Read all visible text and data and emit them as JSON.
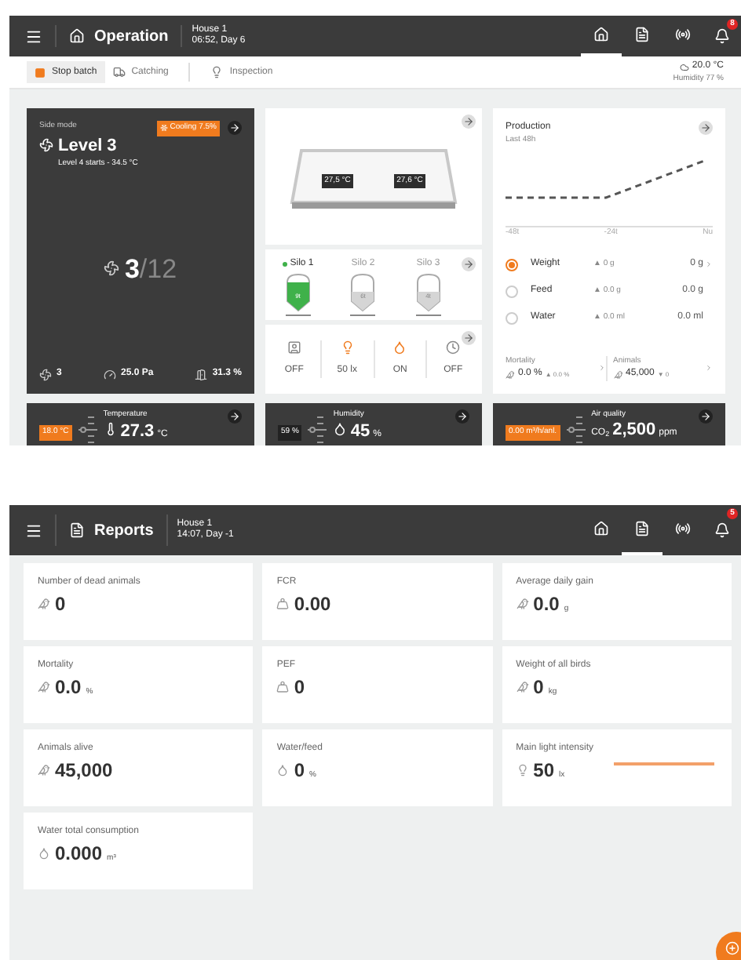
{
  "operation": {
    "header": {
      "title": "Operation",
      "house": "House 1",
      "time": "06:52, Day 6",
      "nav": [
        {
          "selected": true
        },
        {
          "selected": false
        },
        {
          "selected": false
        }
      ],
      "alert_badge": "8"
    },
    "toolbar": {
      "buttons": [
        {
          "label": "Stop batch"
        },
        {
          "label": "Catching"
        },
        {
          "label": "Inspection"
        }
      ],
      "outside_temperature": "20.0 °C",
      "outside_humidity": "Humidity 77 %"
    },
    "ventilation": {
      "mode": "Side mode",
      "badge": "Cooling 7.5%",
      "title": "Level 3",
      "next_level": "Level 4 starts - 34.5 °C",
      "fans_running": "3",
      "fans_total": "/12",
      "stats": [
        "3",
        "25.0 Pa",
        "31.3 %"
      ]
    },
    "house_sensors": [
      "27,5 °C",
      "27,6 °C"
    ],
    "silos": [
      {
        "name": "Silo 1",
        "amount": "9t",
        "selected": true
      },
      {
        "name": "Silo 2",
        "amount": "6t",
        "selected": false
      },
      {
        "name": "Silo 3",
        "amount": "4t",
        "selected": false
      }
    ],
    "devices": [
      {
        "reading": "OFF",
        "on": false
      },
      {
        "reading": "50 lx",
        "on": true
      },
      {
        "reading": "ON",
        "on": true
      },
      {
        "reading": "OFF",
        "on": false
      }
    ],
    "production": {
      "title": "Production",
      "subtitle": "Last 48h",
      "x_labels": [
        "-48t",
        "-24t",
        "Nu"
      ],
      "metrics": [
        {
          "name": "Weight",
          "change": "▲ 0 g",
          "value": "0 g",
          "selected": true
        },
        {
          "name": "Feed",
          "change": "▲ 0.0 g",
          "value": "0.0 g",
          "selected": false
        },
        {
          "name": "Water",
          "change": "▲ 0.0 ml",
          "value": "0.0 ml",
          "selected": false
        }
      ],
      "summary": [
        {
          "label": "Mortality",
          "value": "0.0 %",
          "change": "▲ 0.0 %"
        },
        {
          "label": "Animals",
          "value": "45,000",
          "change": "▼ 0"
        }
      ]
    },
    "climate": [
      {
        "title": "Temperature",
        "setpoint": "18.0 °C",
        "alert": true,
        "value": "27.3",
        "unit": "°C"
      },
      {
        "title": "Humidity",
        "setpoint": "59 %",
        "alert": false,
        "value": "45",
        "unit": "%"
      },
      {
        "title": "Air quality",
        "setpoint": "0.00 m³/h/anl.",
        "alert": true,
        "prefix": "CO$_{2}$",
        "value": "2,500",
        "unit": "ppm"
      }
    ]
  },
  "reports": {
    "header": {
      "title": "Reports",
      "house": "House 1",
      "time": "14:07, Day -1",
      "nav": [
        {
          "selected": false
        },
        {
          "selected": true
        },
        {
          "selected": false
        }
      ],
      "alert_badge": "5"
    },
    "cards": [
      {
        "label": "Number of dead animals",
        "value": "0",
        "kind": "plain"
      },
      {
        "label": "FCR",
        "value": "0.00",
        "kind": "plain"
      },
      {
        "label": "Average daily gain",
        "value": "0.0",
        "unit": "g",
        "kind": "plain"
      },
      {
        "label": "Mortality",
        "value": "0.0",
        "unit": "%",
        "kind": "plain"
      },
      {
        "label": "PEF",
        "value": "0",
        "kind": "plain"
      },
      {
        "label": "Weight of all birds",
        "value": "0",
        "unit": "kg",
        "kind": "plain"
      },
      {
        "label": "Animals alive",
        "value": "45,000",
        "kind": "plain"
      },
      {
        "label": "Water/feed",
        "value": "0",
        "unit": "%",
        "kind": "plain"
      },
      {
        "label": "Main light intensity",
        "value": "50",
        "unit": "lx",
        "kind": "trend"
      },
      {
        "label": "Water total consumption",
        "value": "0.000",
        "unit": "m³",
        "kind": "plain"
      }
    ]
  }
}
